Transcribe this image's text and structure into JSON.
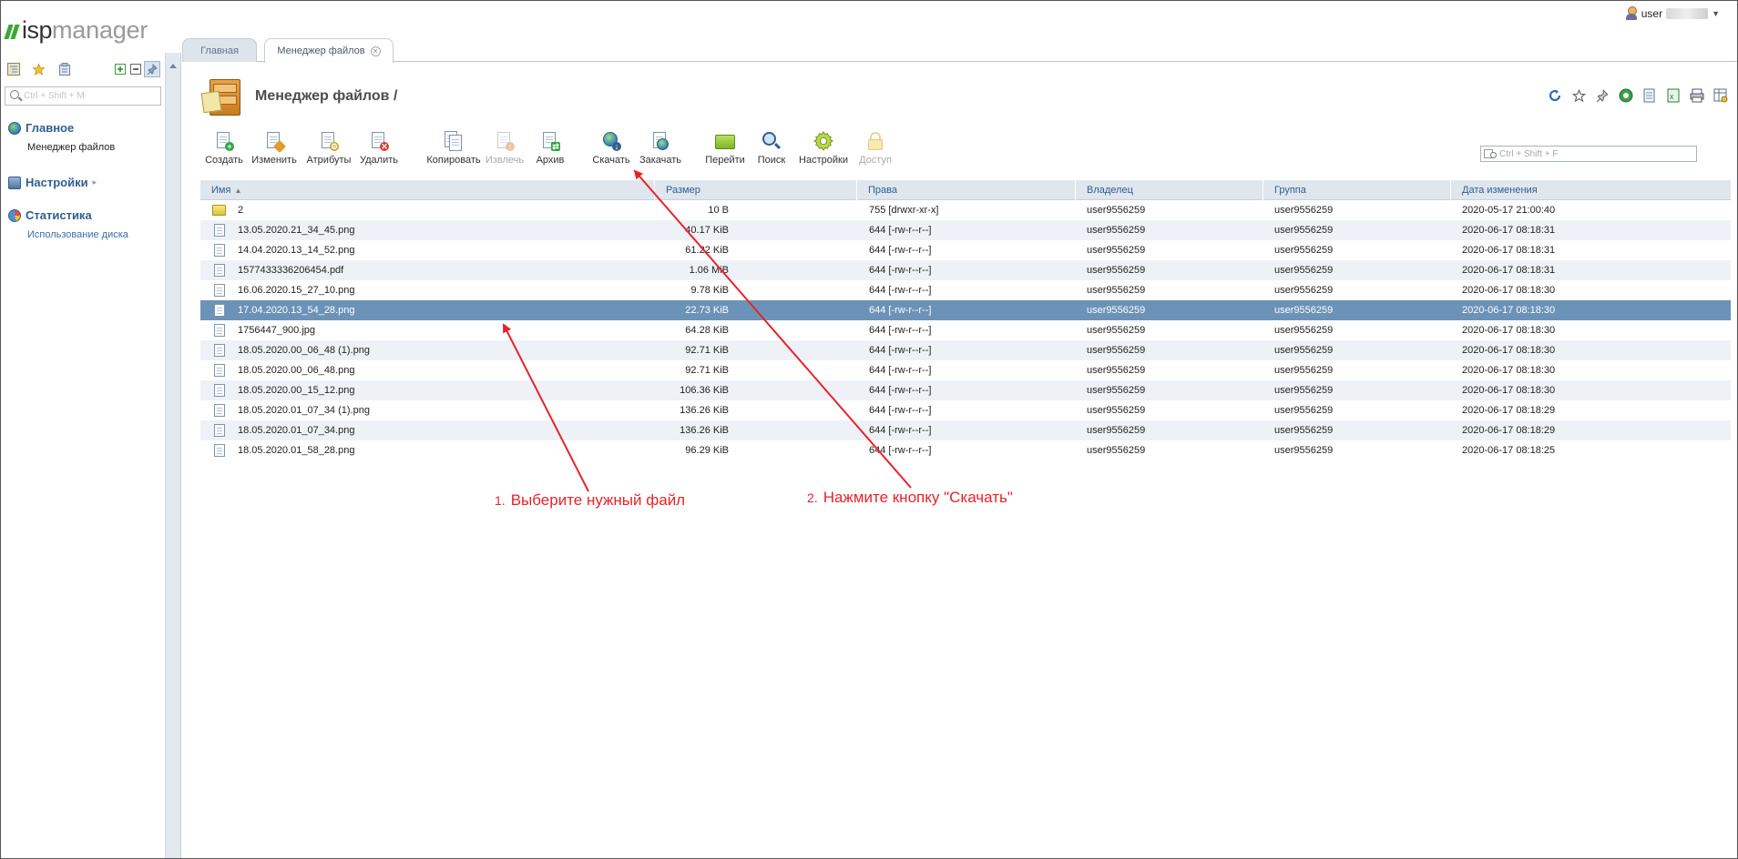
{
  "app": {
    "logo_part1": "isp",
    "logo_part2": "manager",
    "user_name": "user"
  },
  "sidebar": {
    "search_placeholder": "Ctrl + Shift + M",
    "groups": [
      {
        "label": "Главное",
        "items": [
          "Менеджер файлов"
        ]
      },
      {
        "label": "Настройки",
        "items": []
      },
      {
        "label": "Статистика",
        "items": [
          "Использование диска"
        ]
      }
    ]
  },
  "tabs": [
    {
      "label": "Главная"
    },
    {
      "label": "Менеджер файлов"
    }
  ],
  "page": {
    "title": "Менеджер файлов /"
  },
  "toolbar": {
    "buttons": [
      {
        "label": "Создать",
        "enabled": true
      },
      {
        "label": "Изменить",
        "enabled": true
      },
      {
        "label": "Атрибуты",
        "enabled": true
      },
      {
        "label": "Удалить",
        "enabled": true
      },
      {
        "label": "Копировать",
        "enabled": true
      },
      {
        "label": "Извлечь",
        "enabled": false
      },
      {
        "label": "Архив",
        "enabled": true
      },
      {
        "label": "Скачать",
        "enabled": true
      },
      {
        "label": "Закачать",
        "enabled": true
      },
      {
        "label": "Перейти",
        "enabled": true
      },
      {
        "label": "Поиск",
        "enabled": true
      },
      {
        "label": "Настройки",
        "enabled": true
      },
      {
        "label": "Доступ",
        "enabled": false
      }
    ],
    "filter_placeholder": "Ctrl + Shift + F"
  },
  "table": {
    "columns": [
      "Имя",
      "Размер",
      "Права",
      "Владелец",
      "Группа",
      "Дата изменения"
    ],
    "sorted_column": "Имя",
    "selected_row": 5,
    "rows": [
      {
        "type": "folder",
        "name": "2",
        "size": "10 B",
        "perm": "755 [drwxr-xr-x]",
        "owner": "user9556259",
        "group": "user9556259",
        "date": "2020-05-17 21:00:40"
      },
      {
        "type": "file",
        "name": "13.05.2020.21_34_45.png",
        "size": "40.17 KiB",
        "perm": "644 [-rw-r--r--]",
        "owner": "user9556259",
        "group": "user9556259",
        "date": "2020-06-17 08:18:31"
      },
      {
        "type": "file",
        "name": "14.04.2020.13_14_52.png",
        "size": "61.22 KiB",
        "perm": "644 [-rw-r--r--]",
        "owner": "user9556259",
        "group": "user9556259",
        "date": "2020-06-17 08:18:31"
      },
      {
        "type": "file",
        "name": "1577433336206454.pdf",
        "size": "1.06 MiB",
        "perm": "644 [-rw-r--r--]",
        "owner": "user9556259",
        "group": "user9556259",
        "date": "2020-06-17 08:18:31"
      },
      {
        "type": "file",
        "name": "16.06.2020.15_27_10.png",
        "size": "9.78 KiB",
        "perm": "644 [-rw-r--r--]",
        "owner": "user9556259",
        "group": "user9556259",
        "date": "2020-06-17 08:18:30"
      },
      {
        "type": "file",
        "name": "17.04.2020.13_54_28.png",
        "size": "22.73 KiB",
        "perm": "644 [-rw-r--r--]",
        "owner": "user9556259",
        "group": "user9556259",
        "date": "2020-06-17 08:18:30"
      },
      {
        "type": "file",
        "name": "1756447_900.jpg",
        "size": "64.28 KiB",
        "perm": "644 [-rw-r--r--]",
        "owner": "user9556259",
        "group": "user9556259",
        "date": "2020-06-17 08:18:30"
      },
      {
        "type": "file",
        "name": "18.05.2020.00_06_48 (1).png",
        "size": "92.71 KiB",
        "perm": "644 [-rw-r--r--]",
        "owner": "user9556259",
        "group": "user9556259",
        "date": "2020-06-17 08:18:30"
      },
      {
        "type": "file",
        "name": "18.05.2020.00_06_48.png",
        "size": "92.71 KiB",
        "perm": "644 [-rw-r--r--]",
        "owner": "user9556259",
        "group": "user9556259",
        "date": "2020-06-17 08:18:30"
      },
      {
        "type": "file",
        "name": "18.05.2020.00_15_12.png",
        "size": "106.36 KiB",
        "perm": "644 [-rw-r--r--]",
        "owner": "user9556259",
        "group": "user9556259",
        "date": "2020-06-17 08:18:30"
      },
      {
        "type": "file",
        "name": "18.05.2020.01_07_34 (1).png",
        "size": "136.26 KiB",
        "perm": "644 [-rw-r--r--]",
        "owner": "user9556259",
        "group": "user9556259",
        "date": "2020-06-17 08:18:29"
      },
      {
        "type": "file",
        "name": "18.05.2020.01_07_34.png",
        "size": "136.26 KiB",
        "perm": "644 [-rw-r--r--]",
        "owner": "user9556259",
        "group": "user9556259",
        "date": "2020-06-17 08:18:29"
      },
      {
        "type": "file",
        "name": "18.05.2020.01_58_28.png",
        "size": "96.29 KiB",
        "perm": "644 [-rw-r--r--]",
        "owner": "user9556259",
        "group": "user9556259",
        "date": "2020-06-17 08:18:25"
      }
    ]
  },
  "annotations": [
    {
      "num": "1.",
      "text": "Выберите нужный файл"
    },
    {
      "num": "2.",
      "text": "Нажмите кнопку \"Скачать\""
    }
  ],
  "colors": {
    "accent": "#2f5f8f",
    "selected_row": "#6c92b7",
    "annotation": "#e8222a",
    "logo_green": "#39a935"
  }
}
